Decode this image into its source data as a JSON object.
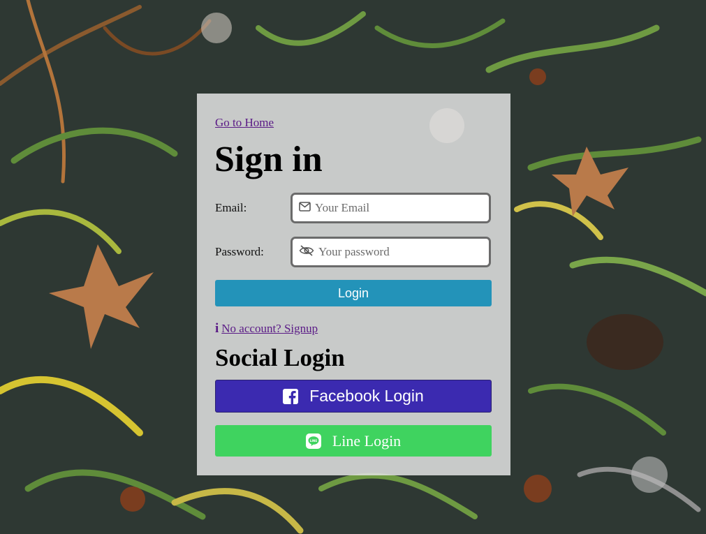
{
  "background": {
    "theme": "evergreen-foliage-photo"
  },
  "card": {
    "home_link": "Go to Home",
    "title": "Sign in",
    "email": {
      "label": "Email:",
      "placeholder": "Your Email",
      "icon": "envelope-icon"
    },
    "password": {
      "label": "Password:",
      "placeholder": "Your password",
      "icon": "eye-slash-icon"
    },
    "login_label": "Login",
    "signup_icon": "i",
    "signup_text": "No account? Signup",
    "social_title": "Social Login",
    "facebook_label": "Facebook Login",
    "line_label": "Line Login"
  },
  "colors": {
    "login": "#2393b9",
    "facebook": "#3b2ab0",
    "line": "#3fd35f",
    "link": "#5a1a86"
  }
}
